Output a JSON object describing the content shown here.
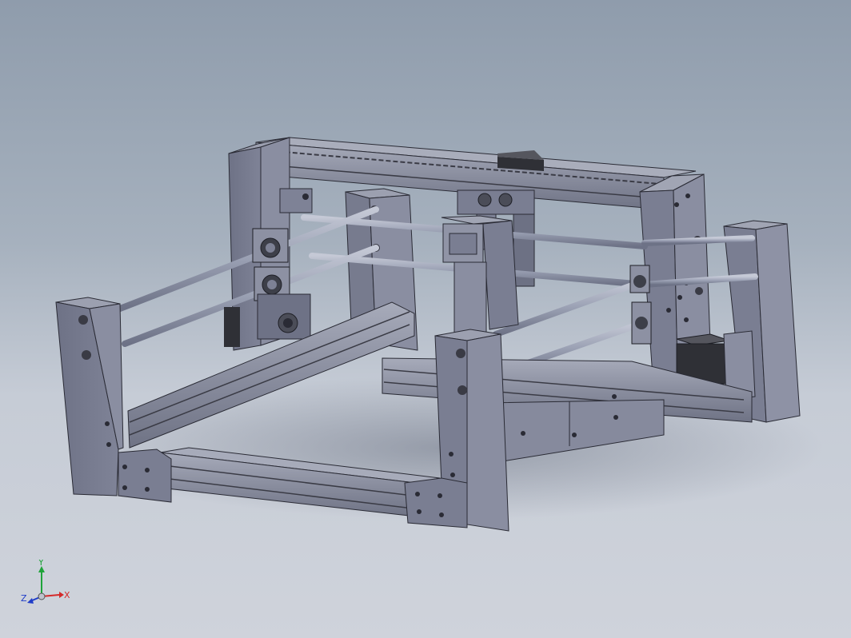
{
  "viewport": {
    "model": "cnc-gantry-frame-assembly",
    "colors": {
      "background_top": "#8f9cac",
      "background_bottom": "#cfd3db",
      "part_face": "#777b8e",
      "part_face_light": "#8a8ea1",
      "part_edge": "#2a2b35",
      "extrusion": "#8c90a0",
      "rod": "#9aa0b3",
      "motor": "#2f3036"
    }
  },
  "triad": {
    "x_label": "X",
    "y_label": "Y",
    "z_label": "Z",
    "x_color": "#d42a2a",
    "y_color": "#1fa33a",
    "z_color": "#1f3cc8"
  }
}
